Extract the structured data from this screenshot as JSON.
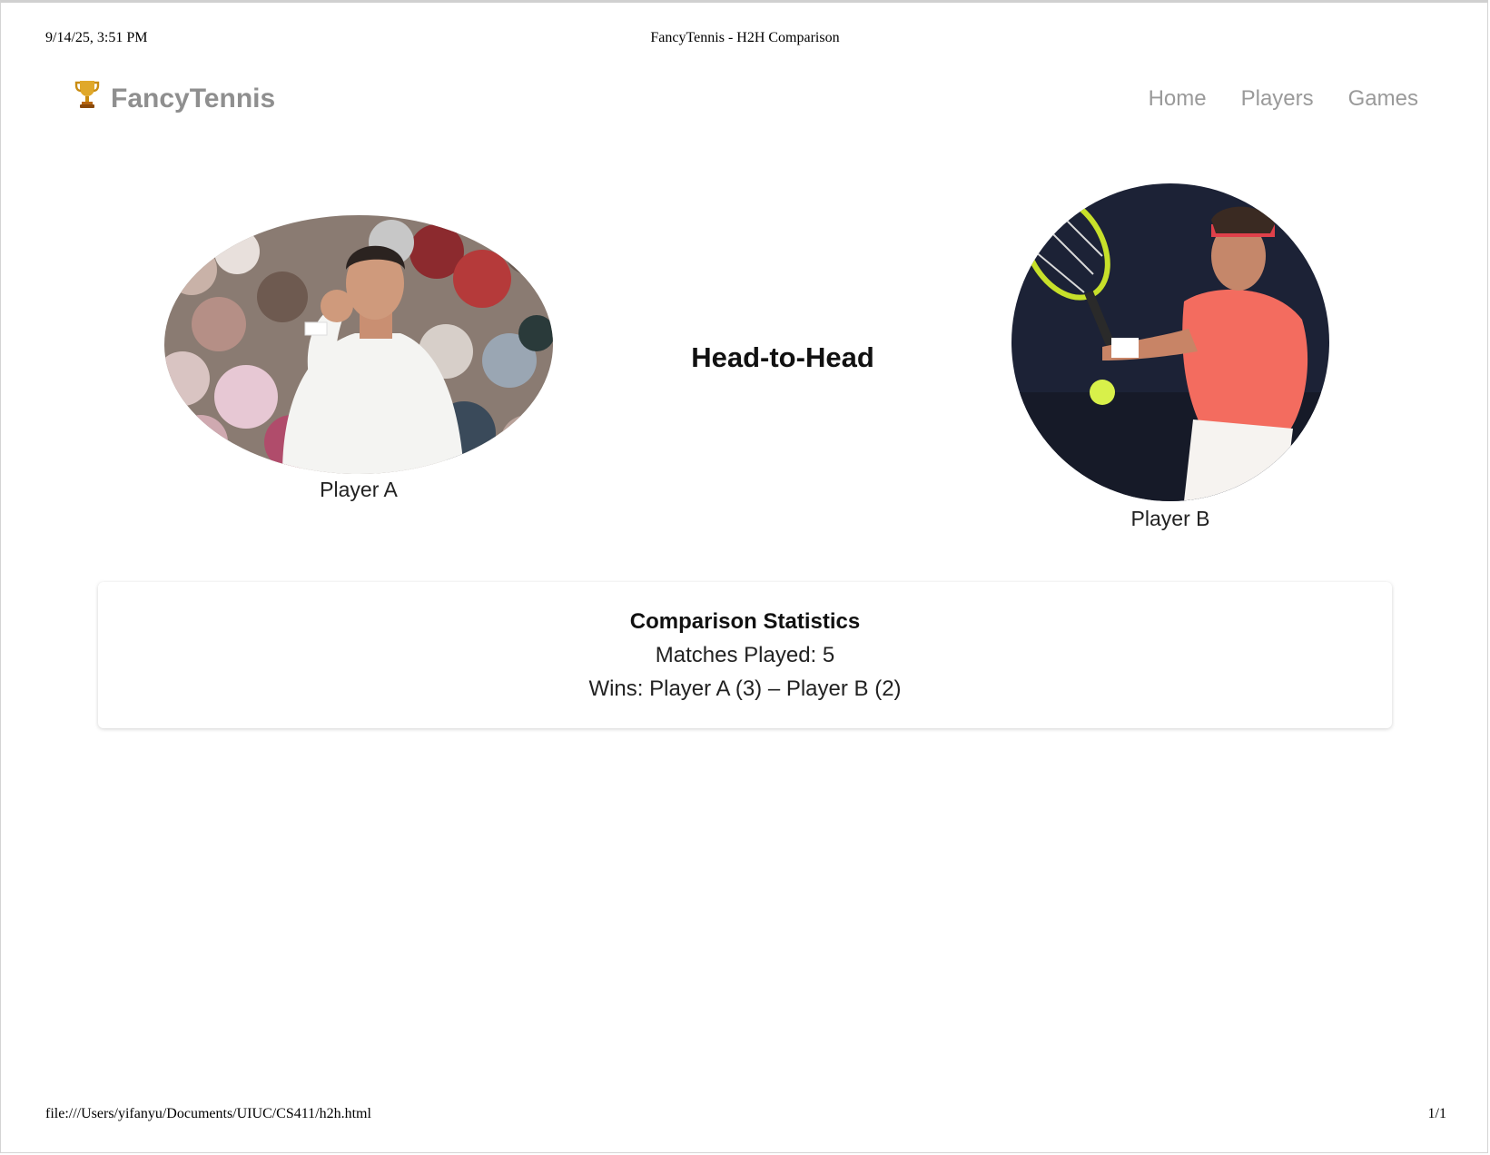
{
  "print_header": {
    "date": "9/14/25, 3:51 PM",
    "title": "FancyTennis - H2H Comparison"
  },
  "print_footer": {
    "url": "file:///Users/yifanyu/Documents/UIUC/CS411/h2h.html",
    "page": "1/1"
  },
  "navbar": {
    "brand_icon": "trophy-icon",
    "brand_name": "FancyTennis",
    "links": [
      "Home",
      "Players",
      "Games"
    ]
  },
  "players": {
    "a": {
      "label": "Player A",
      "photo_icon": "player-photo"
    },
    "b": {
      "label": "Player B",
      "photo_icon": "player-photo"
    }
  },
  "h2h_title": "Head-to-Head",
  "stats": {
    "title": "Comparison Statistics",
    "matches_played": "Matches Played: 5",
    "wins": "Wins: Player A (3) – Player B (2)"
  },
  "colors": {
    "brand_text": "#8f8f8f",
    "nav_link": "#9a9a9a",
    "trophy": "#d9a21a"
  }
}
